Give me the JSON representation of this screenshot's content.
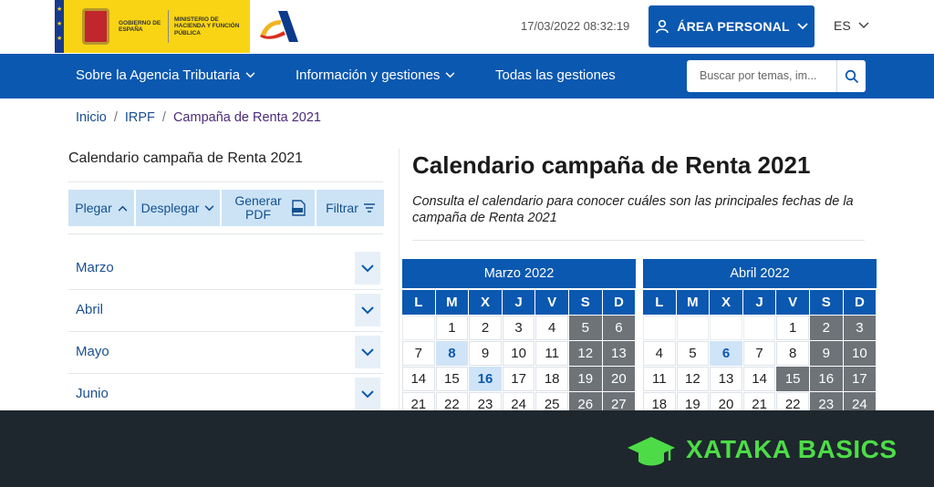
{
  "header": {
    "gov_text_1": "GOBIERNO DE ESPAÑA",
    "gov_text_2": "MINISTERIO DE HACIENDA Y FUNCIÓN PÚBLICA",
    "datetime": "17/03/2022 08:32:19",
    "area_personal_label": "ÁREA PERSONAL",
    "language": "ES"
  },
  "nav": {
    "items": [
      {
        "label": "Sobre la Agencia Tributaria"
      },
      {
        "label": "Información y gestiones"
      },
      {
        "label": "Todas las gestiones"
      }
    ],
    "search_placeholder": "Buscar por temas, im..."
  },
  "breadcrumb": [
    "Inicio",
    "IRPF",
    "Campaña de Renta 2021"
  ],
  "sidebar": {
    "title": "Calendario campaña de Renta 2021",
    "toolbar": {
      "collapse": "Plegar",
      "expand": "Desplegar",
      "pdf": "Generar PDF",
      "filter": "Filtrar"
    },
    "months": [
      "Marzo",
      "Abril",
      "Mayo",
      "Junio"
    ]
  },
  "main": {
    "title": "Calendario campaña de Renta 2021",
    "description": "Consulta el calendario para conocer cuáles son las principales fechas de la campaña de Renta 2021"
  },
  "calendars": {
    "weekdays": [
      "L",
      "M",
      "X",
      "J",
      "V",
      "S",
      "D"
    ],
    "march": {
      "title": "Marzo 2022",
      "weeks": [
        [
          "",
          "1",
          "2",
          "3",
          "4",
          "5",
          "6"
        ],
        [
          "7",
          "8",
          "9",
          "10",
          "11",
          "12",
          "13"
        ],
        [
          "14",
          "15",
          "16",
          "17",
          "18",
          "19",
          "20"
        ],
        [
          "21",
          "22",
          "23",
          "24",
          "25",
          "26",
          "27"
        ]
      ],
      "highlighted": [
        "8",
        "16"
      ],
      "gray_weekdays": []
    },
    "april": {
      "title": "Abril 2022",
      "weeks": [
        [
          "",
          "",
          "",
          "",
          "1",
          "2",
          "3"
        ],
        [
          "4",
          "5",
          "6",
          "7",
          "8",
          "9",
          "10"
        ],
        [
          "11",
          "12",
          "13",
          "14",
          "15",
          "16",
          "17"
        ],
        [
          "18",
          "19",
          "20",
          "21",
          "22",
          "23",
          "24"
        ]
      ],
      "highlighted": [
        "6"
      ],
      "gray_weekdays": [
        "15"
      ]
    }
  },
  "footer": {
    "brand": "XATAKA BASICS"
  },
  "colors": {
    "primary_blue": "#0b58b0",
    "weekend_gray": "#6e7378",
    "highlight_blue": "#cfe4f7",
    "footer_bg": "#1e272d",
    "brand_green": "#4ddc47"
  }
}
